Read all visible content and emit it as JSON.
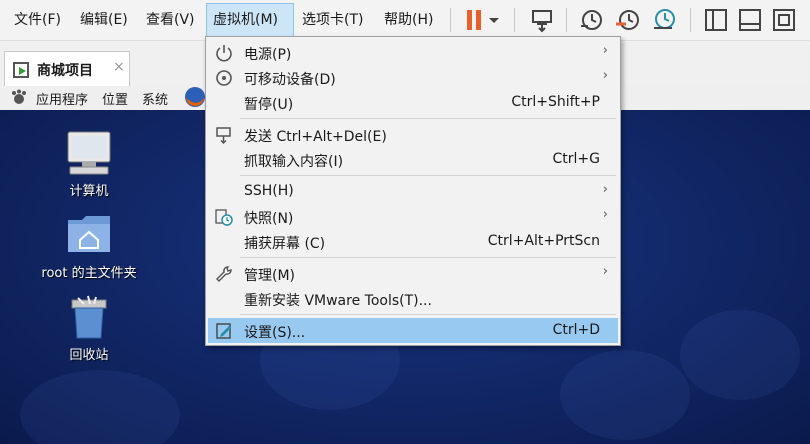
{
  "menubar": {
    "items": [
      {
        "label": "文件(F)"
      },
      {
        "label": "编辑(E)"
      },
      {
        "label": "查看(V)"
      },
      {
        "label": "虚拟机(M)"
      },
      {
        "label": "选项卡(T)"
      },
      {
        "label": "帮助(H)"
      }
    ],
    "toolbar_icons": [
      "pause-icon",
      "dropdown-arrow-icon",
      "send-ctrl-alt-del-icon",
      "snapshot-icon",
      "revert-snapshot-icon",
      "snapshot-manager-icon",
      "sidebar-icon",
      "console-icon",
      "fullscreen-icon",
      "unity-icon"
    ],
    "accent_pause": "#e8602c"
  },
  "tab": {
    "label": "商城项目",
    "close": "×"
  },
  "guest_panel": {
    "apps": "应用程序",
    "places": "位置",
    "system": "系统"
  },
  "desktop": {
    "icons": [
      {
        "label": "计算机",
        "icon": "computer-icon"
      },
      {
        "label": "root 的主文件夹",
        "icon": "home-folder-icon"
      },
      {
        "label": "回收站",
        "icon": "trash-icon"
      }
    ]
  },
  "vm_menu": {
    "items": [
      {
        "label": "电源(P)",
        "shortcut": "",
        "submenu": "›",
        "icon": "power-icon"
      },
      {
        "label": "可移动设备(D)",
        "shortcut": "",
        "submenu": "›",
        "icon": "removable-device-icon"
      },
      {
        "label": "暂停(U)",
        "shortcut": "Ctrl+Shift+P",
        "submenu": ""
      },
      {
        "label": "发送 Ctrl+Alt+Del(E)",
        "shortcut": "",
        "submenu": "",
        "icon": "send-keys-icon"
      },
      {
        "label": "抓取输入内容(I)",
        "shortcut": "Ctrl+G",
        "submenu": ""
      },
      {
        "label": "SSH(H)",
        "shortcut": "",
        "submenu": "›"
      },
      {
        "label": "快照(N)",
        "shortcut": "",
        "submenu": "›",
        "icon": "snapshot-icon"
      },
      {
        "label": "捕获屏幕 (C)",
        "shortcut": "Ctrl+Alt+PrtScn",
        "submenu": ""
      },
      {
        "label": "管理(M)",
        "shortcut": "",
        "submenu": "›",
        "icon": "wrench-icon"
      },
      {
        "label": "重新安装 VMware Tools(T)...",
        "shortcut": "",
        "submenu": ""
      },
      {
        "label": "设置(S)...",
        "shortcut": "Ctrl+D",
        "submenu": "",
        "icon": "settings-icon",
        "highlighted": true
      }
    ]
  }
}
